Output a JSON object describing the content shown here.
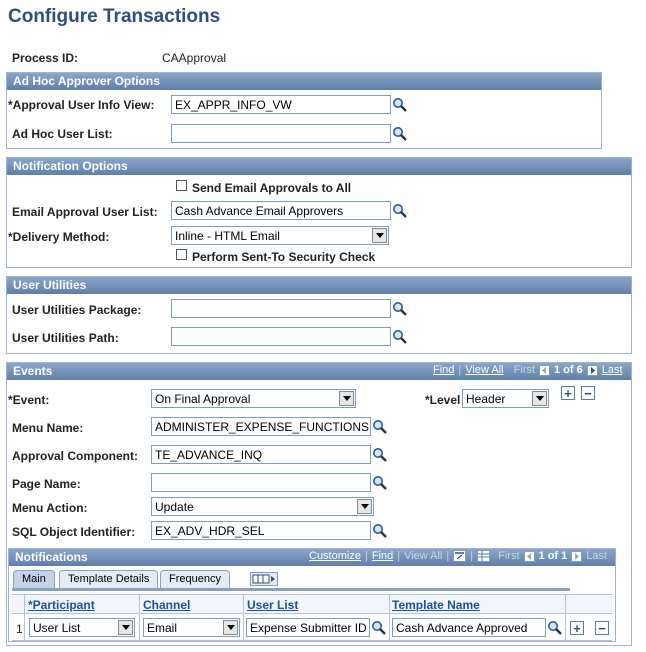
{
  "page": {
    "title": "Configure Transactions"
  },
  "process": {
    "label": "Process ID:",
    "value": "CAApproval"
  },
  "adhoc": {
    "header": "Ad Hoc Approver Options",
    "approval_view_label": "*Approval User Info View:",
    "approval_view_value": "EX_APPR_INFO_VW",
    "user_list_label": "Ad Hoc User List:",
    "user_list_value": ""
  },
  "notification": {
    "header": "Notification Options",
    "send_all_label": "Send Email Approvals to All",
    "send_all_checked": false,
    "email_list_label": "Email Approval User List:",
    "email_list_value": "Cash Advance Email Approvers",
    "delivery_label": "*Delivery Method:",
    "delivery_value": "Inline - HTML Email",
    "security_label": "Perform Sent-To Security Check",
    "security_checked": false
  },
  "utilities": {
    "header": "User Utilities",
    "package_label": "User Utilities Package:",
    "package_value": "",
    "path_label": "User Utilities Path:",
    "path_value": ""
  },
  "events": {
    "header": "Events",
    "nav": {
      "find": "Find",
      "view_all": "View All",
      "first": "First",
      "count": "1 of 6",
      "last": "Last"
    },
    "event_label": "*Event:",
    "event_value": "On Final Approval",
    "level_label": "*Level",
    "level_value": "Header",
    "menu_name_label": "Menu Name:",
    "menu_name_value": "ADMINISTER_EXPENSE_FUNCTIONS",
    "component_label": "Approval Component:",
    "component_value": "TE_ADVANCE_INQ",
    "page_name_label": "Page Name:",
    "page_name_value": "",
    "menu_action_label": "Menu Action:",
    "menu_action_value": "Update",
    "sql_label": "SQL Object Identifier:",
    "sql_value": "EX_ADV_HDR_SEL"
  },
  "notifications": {
    "header": "Notifications",
    "nav": {
      "customize": "Customize",
      "find": "Find",
      "view_all": "View All",
      "first": "First",
      "count": "1 of 1",
      "last": "Last"
    },
    "tabs": [
      "Main",
      "Template Details",
      "Frequency"
    ],
    "columns": [
      "*Participant",
      "Channel",
      "User List",
      "Template Name"
    ],
    "rows": [
      {
        "num": "1",
        "participant": "User List",
        "channel": "Email",
        "user_list": "Expense Submitter ID",
        "template": "Cash Advance Approved"
      }
    ]
  },
  "colors": {
    "title": "#2f4e7f",
    "header_bg": "#6f8fb9",
    "link": "#1a4f9c"
  }
}
